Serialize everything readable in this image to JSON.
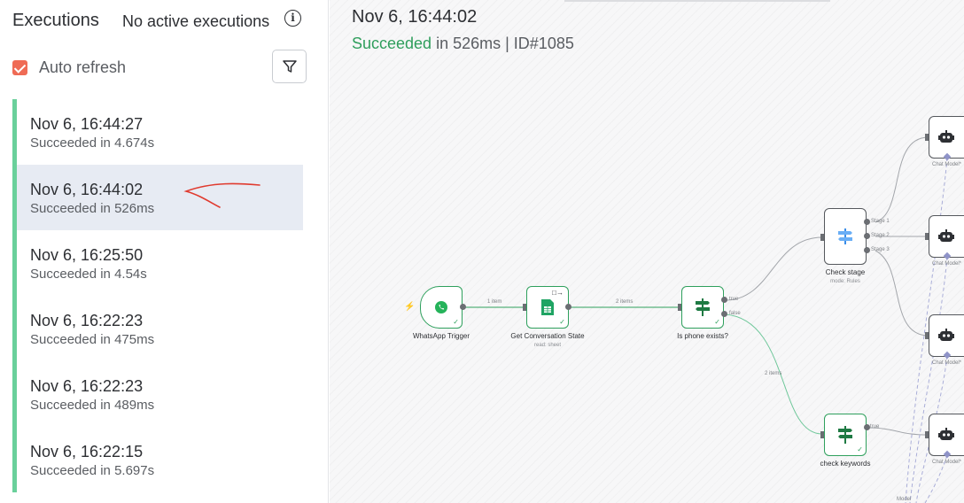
{
  "sidebar": {
    "title": "Executions",
    "status": "No active executions",
    "auto_refresh_label": "Auto refresh",
    "auto_refresh_checked": true,
    "accent_color": "#ef6b55",
    "success_color": "#6ad09b",
    "executions": [
      {
        "time": "Nov 6, 16:44:27",
        "status": "Succeeded in 4.674s",
        "selected": false
      },
      {
        "time": "Nov 6, 16:44:02",
        "status": "Succeeded in 526ms",
        "selected": true
      },
      {
        "time": "Nov 6, 16:25:50",
        "status": "Succeeded in 4.54s",
        "selected": false
      },
      {
        "time": "Nov 6, 16:22:23",
        "status": "Succeeded in 475ms",
        "selected": false
      },
      {
        "time": "Nov 6, 16:22:23",
        "status": "Succeeded in 489ms",
        "selected": false
      },
      {
        "time": "Nov 6, 16:22:15",
        "status": "Succeeded in 5.697s",
        "selected": false
      }
    ]
  },
  "canvas": {
    "title": "Nov 6, 16:44:02",
    "status_word": "Succeeded",
    "status_rest": " in 526ms | ID#1085",
    "nodes": {
      "whatsapp": {
        "label": "WhatsApp Trigger",
        "icon": "whatsapp-icon"
      },
      "sheets": {
        "label": "Get Conversation State",
        "sub": "read: sheet",
        "icon": "google-sheets-icon"
      },
      "phone": {
        "label": "Is phone exists?",
        "icon": "signpost-icon"
      },
      "stage": {
        "label": "Check stage",
        "sub": "mode: Rules",
        "icon": "switch-icon"
      },
      "keywords": {
        "label": "check keywords",
        "icon": "signpost-icon"
      },
      "agent_label": "Chat Model*"
    },
    "edge_labels": {
      "e1": "1 item",
      "e2": "2 items",
      "e3": "2 items",
      "true": "true",
      "false": "false",
      "stage1": "Stage 1",
      "stage2": "Stage 2",
      "stage3": "Stage 3",
      "kw_true": "true",
      "model": "Model"
    }
  }
}
